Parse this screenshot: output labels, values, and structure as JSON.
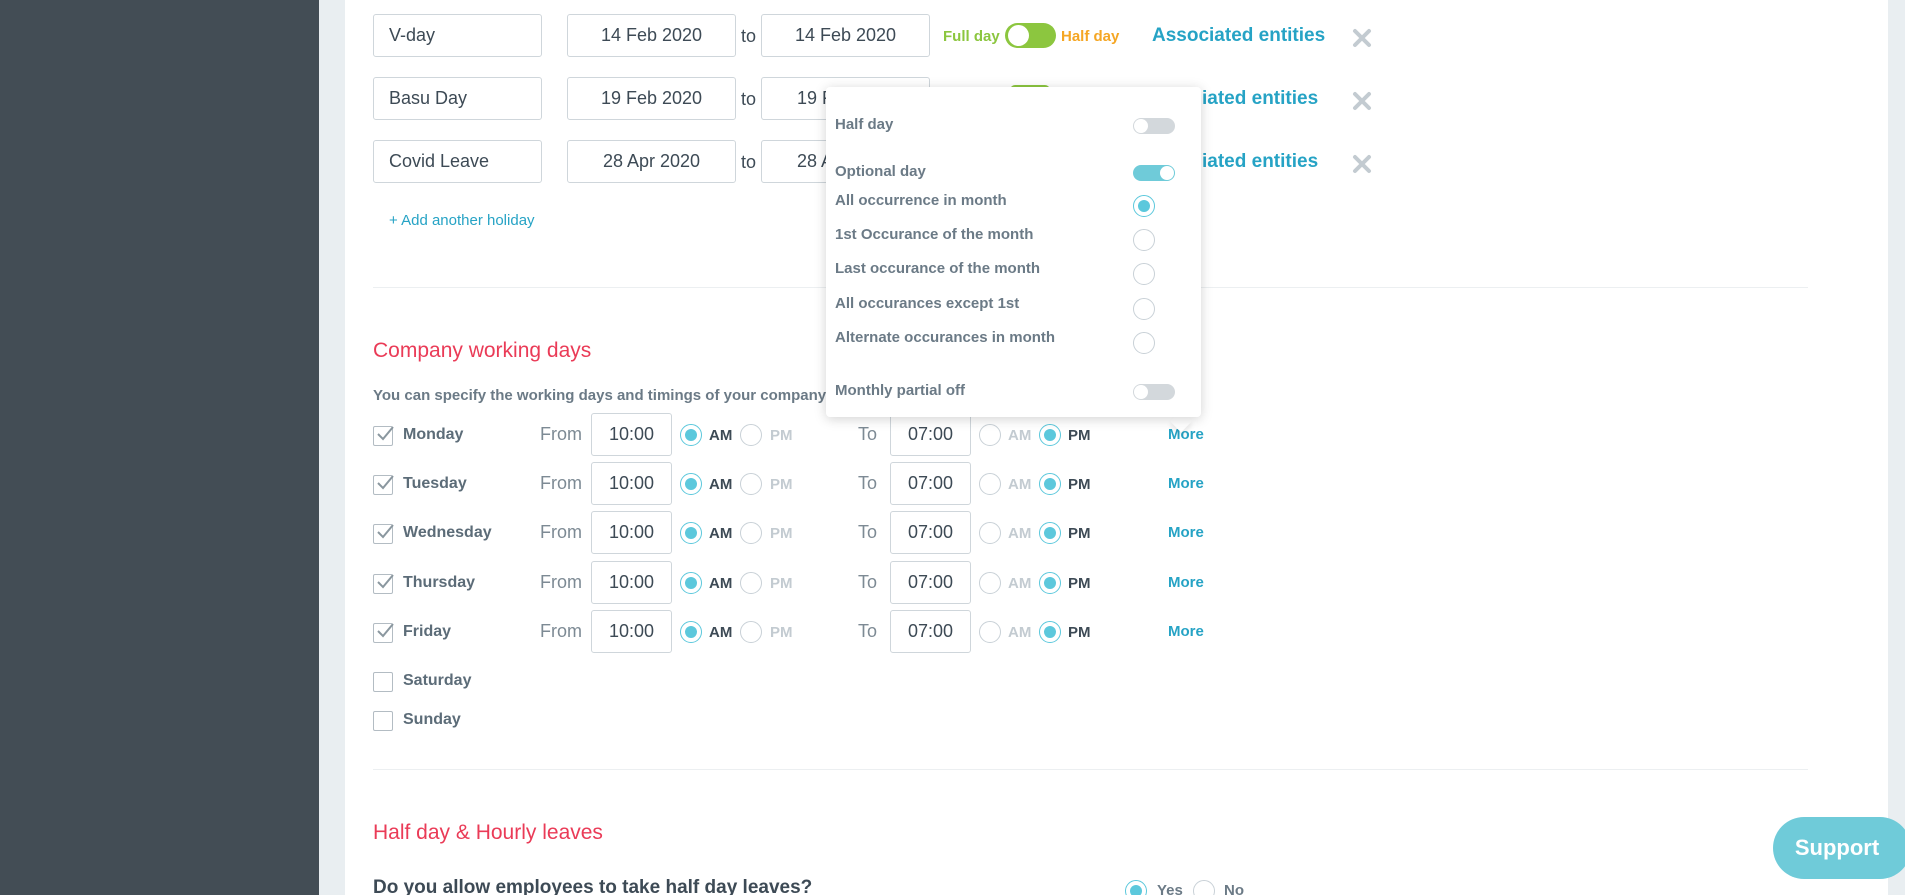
{
  "holidays": [
    {
      "name": "V-day",
      "from": "14 Feb 2020",
      "to": "14 Feb 2020",
      "to_sep": "to",
      "full_day": "Full day",
      "half_day": "Half day",
      "assoc": "Associated entities"
    },
    {
      "name": "Basu Day",
      "from": "19 Feb 2020",
      "to": "19 F",
      "to_sep": "to",
      "assoc": "iated entities"
    },
    {
      "name": "Covid Leave",
      "from": "28 Apr 2020",
      "to": "28 A",
      "to_sep": "to",
      "assoc": "iated entities"
    }
  ],
  "add_holiday": "+ Add another holiday",
  "working_days": {
    "title": "Company working days",
    "subtitle": "You can specify the working days and timings of your company",
    "from_label": "From",
    "to_label": "To",
    "am": "AM",
    "pm": "PM",
    "more": "More",
    "days": [
      {
        "label": "Monday",
        "checked": true,
        "from": "10:00",
        "to": "07:00"
      },
      {
        "label": "Tuesday",
        "checked": true,
        "from": "10:00",
        "to": "07:00"
      },
      {
        "label": "Wednesday",
        "checked": true,
        "from": "10:00",
        "to": "07:00"
      },
      {
        "label": "Thursday",
        "checked": true,
        "from": "10:00",
        "to": "07:00"
      },
      {
        "label": "Friday",
        "checked": true,
        "from": "10:00",
        "to": "07:00"
      },
      {
        "label": "Saturday",
        "checked": false
      },
      {
        "label": "Sunday",
        "checked": false
      }
    ]
  },
  "popup": {
    "half_day": "Half day",
    "optional_day": "Optional day",
    "options": [
      "All occurrence in month",
      "1st Occurance of the month",
      "Last occurance of the month",
      "All occurances except 1st",
      "Alternate occurances in month"
    ],
    "monthly_partial": "Monthly partial off"
  },
  "half_day_section": {
    "title": "Half day & Hourly leaves",
    "question": "Do you allow employees to take half day leaves?",
    "yes": "Yes",
    "no": "No"
  },
  "support": "Support",
  "colors": {
    "accent": "#26a3c5",
    "section_title": "#ea3b57",
    "toggle_green": "#8cc63f",
    "radio": "#5cc8dc"
  }
}
